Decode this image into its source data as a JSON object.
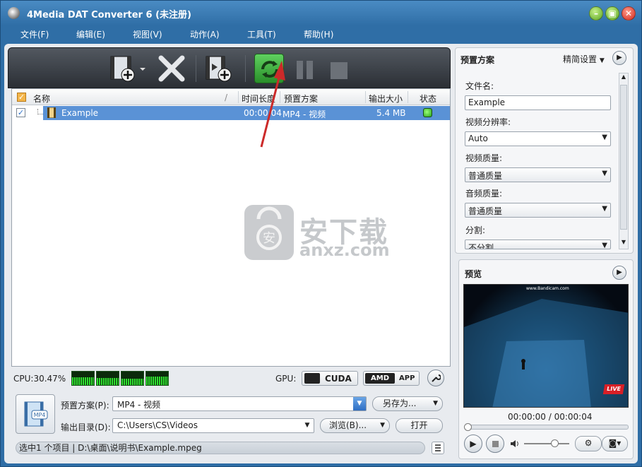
{
  "window": {
    "title": "4Media DAT Converter 6 (未注册)"
  },
  "menu": [
    "文件(F)",
    "编辑(E)",
    "视图(V)",
    "动作(A)",
    "工具(T)",
    "帮助(H)"
  ],
  "list": {
    "columns": [
      "名称",
      "/",
      "时间长度",
      "预置方案",
      "输出大小",
      "状态"
    ],
    "rows": [
      {
        "name": "Example",
        "duration": "00:00:04",
        "profile": "MP4 - 视频",
        "size": "5.4 MB",
        "checked": true
      }
    ]
  },
  "watermark": {
    "main": "安下载",
    "sub": "anxz.com"
  },
  "perf": {
    "cpu": "CPU:30.47%",
    "gpu_label": "GPU:",
    "cuda": "CUDA",
    "amd": "AMD",
    "app": "APP"
  },
  "bottom": {
    "profile_label": "预置方案(P):",
    "profile_value": "MP4 - 视频",
    "save_as": "另存为...",
    "output_label": "输出目录(D):",
    "output_value": "C:\\Users\\CS\\Videos",
    "browse": "浏览(B)...",
    "open": "打开",
    "icon_label": "MP4"
  },
  "status_text": "选中1 个项目 | D:\\桌面\\说明书\\Example.mpeg",
  "right": {
    "title": "预置方案",
    "settings": "精简设置",
    "filename_label": "文件名:",
    "filename_value": "Example",
    "resolution_label": "视频分辨率:",
    "resolution_value": "Auto",
    "vquality_label": "视频质量:",
    "vquality_value": "普通质量",
    "aquality_label": "音频质量:",
    "aquality_value": "普通质量",
    "split_label": "分割:",
    "split_value": "不分割"
  },
  "preview": {
    "title": "预览",
    "time": "00:00:00 / 00:00:04",
    "video_watermark": "www.Bandicam.com",
    "live_badge": "LIVE"
  },
  "colors": {
    "titlebar": "#2f6ea6",
    "selection": "#5a92d6",
    "convert": "#3dae3d"
  }
}
